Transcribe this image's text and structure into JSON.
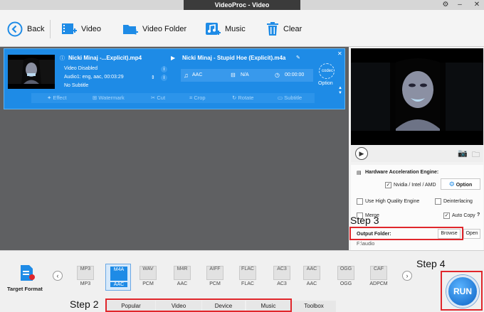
{
  "window": {
    "title": "VideoProc - Video"
  },
  "toolbar": {
    "back": "Back",
    "video": "Video",
    "video_folder": "Video Folder",
    "music": "Music",
    "clear": "Clear"
  },
  "task": {
    "source_name": "Nicki Minaj -...Explicit).mp4",
    "video_status": "Video Disabled",
    "audio_track": "Audio1: eng, aac, 00:03:29",
    "subtitle": "No Subtitle",
    "output_name": "Nicki Minaj - Stupid Hoe (Explicit).m4a",
    "codec": "AAC",
    "size": "N/A",
    "duration": "00:00:00",
    "codec_label": "codec",
    "option_label": "Option",
    "info_badge": "i",
    "edit_tools": [
      "Effect",
      "Watermark",
      "Cut",
      "Crop",
      "Rotate",
      "Subtitle"
    ]
  },
  "settings": {
    "hw_title": "Hardware Acceleration Engine:",
    "nvidia": "Nvidia / Intel / AMD",
    "option_button": "Option",
    "high_quality": "Use High Quality Engine",
    "deinterlacing": "Deinterlacing",
    "merge": "Merge",
    "auto_copy": "Auto Copy",
    "help": "?",
    "output_folder_label": "Output Folder:",
    "browse": "Browse",
    "open": "Open",
    "path": "F:\\audio"
  },
  "steps": {
    "step2": "Step 2",
    "step3": "Step 3",
    "step4": "Step 4"
  },
  "bottom": {
    "target_format": "Target Format",
    "formats": [
      {
        "top": "MP3",
        "bottom": "MP3"
      },
      {
        "top": "M4A",
        "bottom": "AAC"
      },
      {
        "top": "WAV",
        "bottom": "PCM"
      },
      {
        "top": "M4R",
        "bottom": "AAC"
      },
      {
        "top": "AIFF",
        "bottom": "PCM"
      },
      {
        "top": "FLAC",
        "bottom": "FLAC"
      },
      {
        "top": "AC3",
        "bottom": "AC3"
      },
      {
        "top": "AAC",
        "bottom": "AAC"
      },
      {
        "top": "OGG",
        "bottom": "OGG"
      },
      {
        "top": "CAF",
        "bottom": "ADPCM"
      }
    ],
    "selected_format_index": 1,
    "tabs": [
      "Popular",
      "Video",
      "Device",
      "Music",
      "Toolbox"
    ],
    "run": "RUN"
  },
  "colors": {
    "accent": "#1e8be6",
    "highlight": "#e0262b"
  }
}
